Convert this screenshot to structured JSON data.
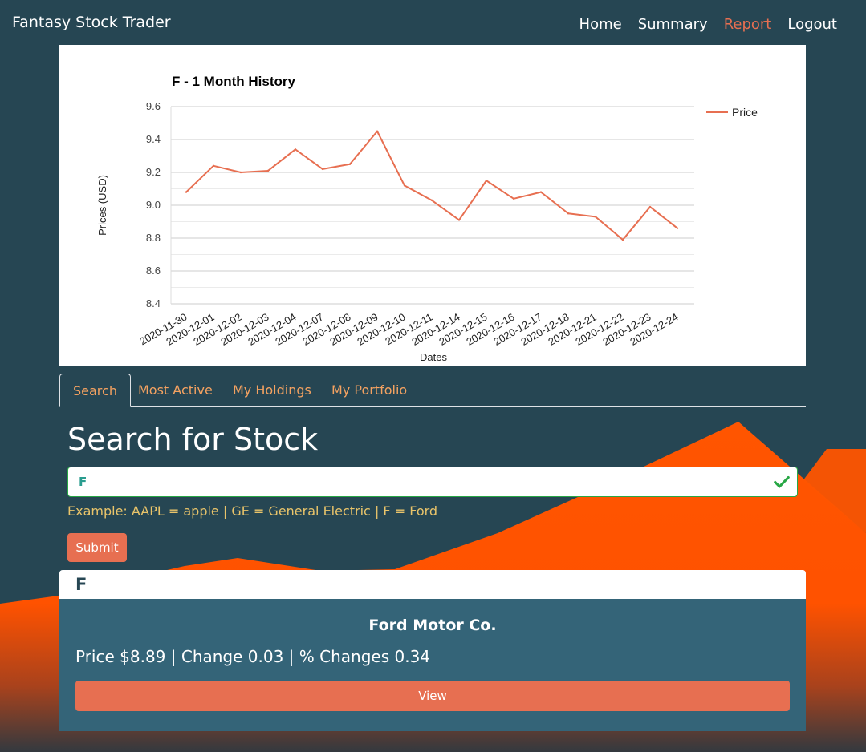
{
  "navbar": {
    "brand": "Fantasy Stock Trader",
    "links": [
      {
        "label": "Home",
        "active": false
      },
      {
        "label": "Summary",
        "active": false
      },
      {
        "label": "Report",
        "active": true
      },
      {
        "label": "Logout",
        "active": false
      }
    ]
  },
  "chart_data": {
    "type": "line",
    "title": "F - 1 Month History",
    "xlabel": "Dates",
    "ylabel": "Prices (USD)",
    "ylim": [
      8.4,
      9.6
    ],
    "yticks": [
      "9.6",
      "9.4",
      "9.2",
      "9.0",
      "8.8",
      "8.6",
      "8.4"
    ],
    "grid": true,
    "legend_position": "right",
    "categories": [
      "2020-11-30",
      "2020-12-01",
      "2020-12-02",
      "2020-12-03",
      "2020-12-04",
      "2020-12-07",
      "2020-12-08",
      "2020-12-09",
      "2020-12-10",
      "2020-12-11",
      "2020-12-14",
      "2020-12-15",
      "2020-12-16",
      "2020-12-17",
      "2020-12-18",
      "2020-12-21",
      "2020-12-22",
      "2020-12-23",
      "2020-12-24"
    ],
    "series": [
      {
        "name": "Price",
        "color": "#e76f51",
        "values": [
          9.08,
          9.24,
          9.2,
          9.21,
          9.34,
          9.22,
          9.25,
          9.45,
          9.12,
          9.03,
          8.91,
          9.15,
          9.04,
          9.08,
          8.95,
          8.93,
          8.79,
          8.99,
          8.86
        ]
      }
    ]
  },
  "tabs": [
    {
      "label": "Search",
      "active": true
    },
    {
      "label": "Most Active",
      "active": false
    },
    {
      "label": "My Holdings",
      "active": false
    },
    {
      "label": "My Portfolio",
      "active": false
    }
  ],
  "search": {
    "title": "Search for Stock",
    "input_value": "F",
    "example": "Example: AAPL = apple | GE = General Electric | F = Ford",
    "submit_label": "Submit",
    "valid_icon": "check-icon"
  },
  "result": {
    "symbol": "F",
    "company": "Ford Motor Co.",
    "quote": "Price $8.89 | Change 0.03 | % Changes 0.34",
    "view_label": "View"
  },
  "colors": {
    "background": "#264653",
    "accent": "#e76f51",
    "tab_text": "#f4a261",
    "example_text": "#e9c46a",
    "mountain": "#ff5500",
    "card_body": "#346478",
    "valid_border": "#28a745"
  }
}
